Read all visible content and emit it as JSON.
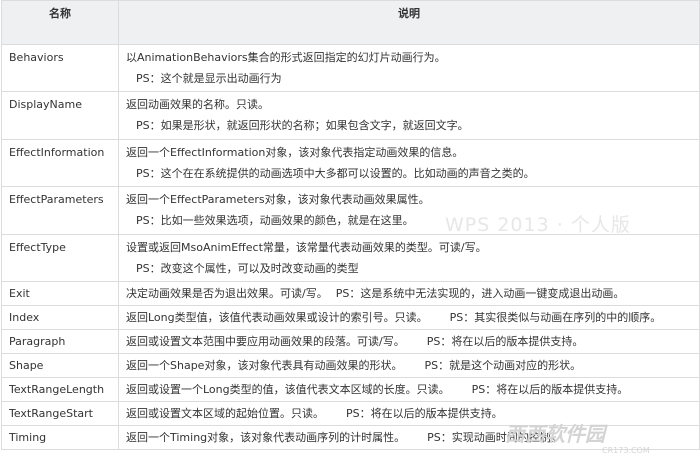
{
  "table": {
    "headers": [
      "名称",
      "说明"
    ],
    "rows": [
      {
        "name": "Behaviors",
        "desc": "以AnimationBehaviors集合的形式返回指定的幻灯片动画行为。",
        "ps": "PS：这个就是显示出动画行为"
      },
      {
        "name": "DisplayName",
        "desc": "返回动画效果的名称。只读。",
        "ps": "PS：如果是形状，就返回形状的名称；如果包含文字，就返回文字。"
      },
      {
        "name": "EffectInformation",
        "desc": "返回一个EffectInformation对象，该对象代表指定动画效果的信息。",
        "ps": "PS：这个在在系统提供的动画选项中大多都可以设置的。比如动画的声音之类的。"
      },
      {
        "name": "EffectParameters",
        "desc": "返回一个EffectParameters对象，该对象代表动画效果属性。",
        "ps": "PS：比如一些效果选项，动画效果的颜色，就是在这里。"
      },
      {
        "name": "EffectType",
        "desc": "设置或返回MsoAnimEffect常量，该常量代表动画效果的类型。可读/写。",
        "ps": "PS：改变这个属性，可以及时改变动画的类型"
      },
      {
        "name": "Exit",
        "desc": "决定动画效果是否为退出效果。可读/写。",
        "ps": "PS：这是系统中无法实现的，进入动画一键变成退出动画。"
      },
      {
        "name": "Index",
        "desc": "返回Long类型值，该值代表动画效果或设计的索引号。只读。",
        "ps": "PS：其实很类似与动画在序列的中的顺序。"
      },
      {
        "name": "Paragraph",
        "desc": "返回或设置文本范围中要应用动画效果的段落。可读/写。",
        "ps": "PS：将在以后的版本提供支持。"
      },
      {
        "name": "Shape",
        "desc": "返回一个Shape对象，该对象代表具有动画效果的形状。",
        "ps": "PS：就是这个动画对应的形状。"
      },
      {
        "name": "TextRangeLength",
        "desc": "返回或设置一个Long类型的值，该值代表文本区域的长度。只读。",
        "ps": "PS：将在以后的版本提供支持。"
      },
      {
        "name": "TextRangeStart",
        "desc": "返回或设置文本区域的起始位置。只读。",
        "ps": "PS：将在以后的版本提供支持。"
      },
      {
        "name": "Timing",
        "desc": "返回一个Timing对象，该对象代表动画序列的计时属性。",
        "ps": "PS：实现动画时间的控制。"
      }
    ]
  },
  "watermark": {
    "wps": "WPS 2013 · 个人版",
    "site": "西西软件园",
    "url": "CR173.COM"
  },
  "colors": {
    "header_bg": "#eef0f2",
    "border": "#dcdcdc",
    "text": "#333333"
  }
}
